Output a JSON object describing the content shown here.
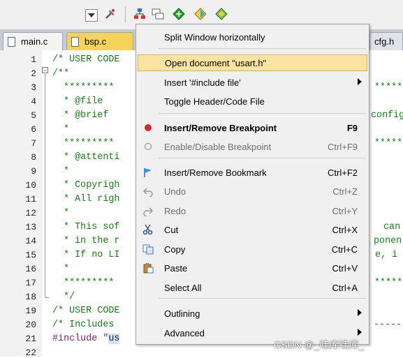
{
  "toolbar": {
    "icons": [
      "dropdown-icon",
      "pin-icon",
      "hierarchy-icon",
      "windows-icon",
      "green-diamond-icon",
      "yellow-diamond-icon",
      "grid-icon"
    ]
  },
  "tabs": [
    {
      "label": "main.c"
    },
    {
      "label": "bsp.c"
    },
    {
      "label": "cfg.h"
    }
  ],
  "editor": {
    "line_numbers": [
      "1",
      "2",
      "3",
      "4",
      "5",
      "6",
      "7",
      "8",
      "9",
      "10",
      "11",
      "12",
      "13",
      "14",
      "15",
      "16",
      "17",
      "18",
      "19",
      "20",
      "21",
      "22"
    ],
    "lines": [
      {
        "text": "/* USER CODE",
        "type": "comment"
      },
      {
        "text": "/**",
        "type": "comment"
      },
      {
        "text": "  *********",
        "type": "comment"
      },
      {
        "text": "  * @file",
        "type": "comment"
      },
      {
        "text": "  * @brief",
        "type": "comment"
      },
      {
        "text": "  *",
        "type": "comment"
      },
      {
        "text": "  *********",
        "type": "comment"
      },
      {
        "text": "  * @attenti",
        "type": "comment"
      },
      {
        "text": "  *",
        "type": "comment"
      },
      {
        "text": "  * Copyrigh",
        "type": "comment"
      },
      {
        "text": "  * All righ",
        "type": "comment"
      },
      {
        "text": "  *",
        "type": "comment"
      },
      {
        "text": "  * This sof",
        "type": "comment"
      },
      {
        "text": "  * in the r",
        "type": "comment"
      },
      {
        "text": "  * If no LI",
        "type": "comment"
      },
      {
        "text": "  *",
        "type": "comment"
      },
      {
        "text": "  *********",
        "type": "comment"
      },
      {
        "text": "  */",
        "type": "comment"
      },
      {
        "text": "/* USER CODE",
        "type": "comment"
      },
      {
        "text": "/* Includes",
        "type": "comment"
      },
      {
        "text": "#include \"",
        "type": "pre"
      },
      {
        "text": "",
        "type": "comment"
      }
    ],
    "right_fragments": [
      {
        "text": "********",
        "line": 3
      },
      {
        "text": "config",
        "line": 5
      },
      {
        "text": "*******",
        "line": 7
      },
      {
        "text": "can",
        "line": 13
      },
      {
        "text": "ponen",
        "line": 14
      },
      {
        "text": "e, i",
        "line": 15
      },
      {
        "text": "*******",
        "line": 17
      },
      {
        "text": "-----",
        "line": 20
      }
    ],
    "selected_word": "us"
  },
  "context_menu": {
    "items": [
      {
        "label": "Split Window horizontally",
        "shortcut": "",
        "icon": "",
        "bold": false,
        "disabled": false,
        "submenu": false,
        "highlighted": false
      },
      {
        "label": "Open document \"usart.h\"",
        "shortcut": "",
        "icon": "",
        "bold": false,
        "disabled": false,
        "submenu": false,
        "highlighted": true
      },
      {
        "label": "Insert '#include file'",
        "shortcut": "",
        "icon": "",
        "bold": false,
        "disabled": false,
        "submenu": true,
        "highlighted": false
      },
      {
        "label": "Toggle Header/Code File",
        "shortcut": "",
        "icon": "",
        "bold": false,
        "disabled": false,
        "submenu": false,
        "highlighted": false
      },
      {
        "label": "Insert/Remove Breakpoint",
        "shortcut": "F9",
        "icon": "breakpoint-red-icon",
        "bold": true,
        "disabled": false,
        "submenu": false,
        "highlighted": false
      },
      {
        "label": "Enable/Disable Breakpoint",
        "shortcut": "Ctrl+F9",
        "icon": "breakpoint-disabled-icon",
        "bold": false,
        "disabled": true,
        "submenu": false,
        "highlighted": false
      },
      {
        "label": "Insert/Remove Bookmark",
        "shortcut": "Ctrl+F2",
        "icon": "bookmark-flag-icon",
        "bold": false,
        "disabled": false,
        "submenu": false,
        "highlighted": false
      },
      {
        "label": "Undo",
        "shortcut": "Ctrl+Z",
        "icon": "undo-icon",
        "bold": false,
        "disabled": true,
        "submenu": false,
        "highlighted": false
      },
      {
        "label": "Redo",
        "shortcut": "Ctrl+Y",
        "icon": "redo-icon",
        "bold": false,
        "disabled": true,
        "submenu": false,
        "highlighted": false
      },
      {
        "label": "Cut",
        "shortcut": "Ctrl+X",
        "icon": "scissors-icon",
        "bold": false,
        "disabled": false,
        "submenu": false,
        "highlighted": false
      },
      {
        "label": "Copy",
        "shortcut": "Ctrl+C",
        "icon": "copy-icon",
        "bold": false,
        "disabled": false,
        "submenu": false,
        "highlighted": false
      },
      {
        "label": "Paste",
        "shortcut": "Ctrl+V",
        "icon": "paste-icon",
        "bold": false,
        "disabled": false,
        "submenu": false,
        "highlighted": false
      },
      {
        "label": "Select All",
        "shortcut": "Ctrl+A",
        "icon": "",
        "bold": false,
        "disabled": false,
        "submenu": false,
        "highlighted": false
      },
      {
        "label": "Outlining",
        "shortcut": "",
        "icon": "",
        "bold": false,
        "disabled": false,
        "submenu": true,
        "highlighted": false
      },
      {
        "label": "Advanced",
        "shortcut": "",
        "icon": "",
        "bold": false,
        "disabled": false,
        "submenu": true,
        "highlighted": false
      }
    ]
  },
  "watermark": "CSDN @_哇库哇库_",
  "colors": {
    "comment": "#1b7a1b",
    "preprocessor": "#7c1f7c",
    "menu_highlight": "#fbe3a3",
    "active_tab": "#f6d25a"
  }
}
